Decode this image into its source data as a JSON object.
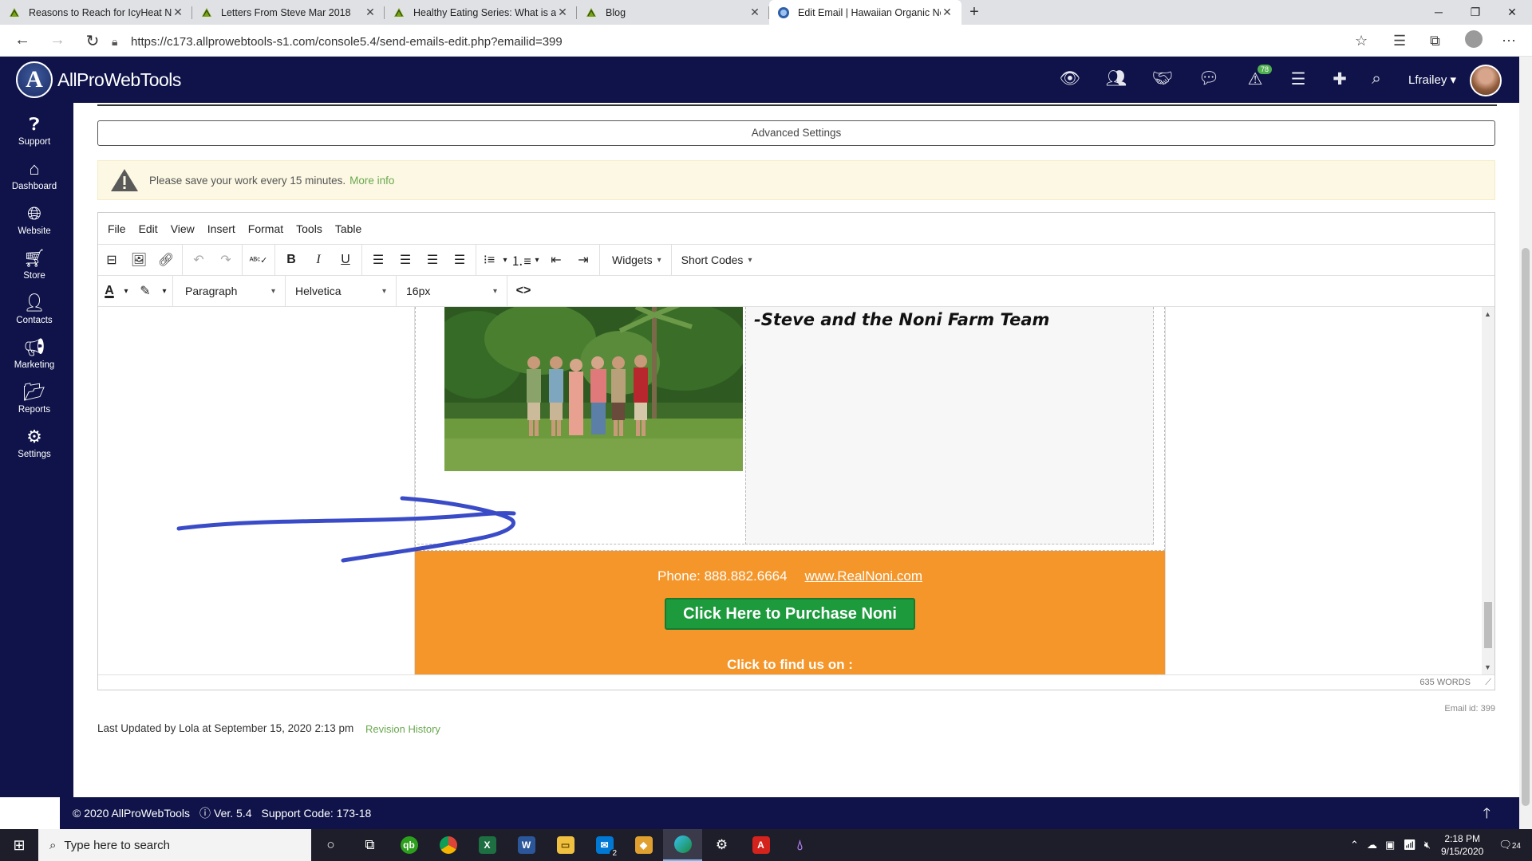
{
  "browser": {
    "tabs": [
      {
        "title": "Reasons to Reach for IcyHeat No",
        "active": false
      },
      {
        "title": "Letters From Steve Mar 2018",
        "active": false
      },
      {
        "title": "Healthy Eating Series: What is a",
        "active": false
      },
      {
        "title": "Blog",
        "active": false
      },
      {
        "title": "Edit Email | Hawaiian Organic No",
        "active": true
      }
    ],
    "url": "https://c173.allprowebtools-s1.com/console5.4/send-emails-edit.php?emailid=399"
  },
  "header": {
    "brand": "AllProWebTools",
    "notification_count": "78",
    "username": "Lfrailey"
  },
  "sidebar": {
    "items": [
      {
        "label": "Support",
        "icon": "question-icon"
      },
      {
        "label": "Dashboard",
        "icon": "home-icon"
      },
      {
        "label": "Website",
        "icon": "globe-icon"
      },
      {
        "label": "Store",
        "icon": "cart-icon"
      },
      {
        "label": "Contacts",
        "icon": "user-icon"
      },
      {
        "label": "Marketing",
        "icon": "megaphone-icon"
      },
      {
        "label": "Reports",
        "icon": "folder-icon"
      },
      {
        "label": "Settings",
        "icon": "gear-icon"
      }
    ]
  },
  "main": {
    "advanced_settings": "Advanced Settings",
    "warning_text": "Please save your work every 15 minutes.",
    "warning_link": "More info"
  },
  "editor": {
    "menu": [
      "File",
      "Edit",
      "View",
      "Insert",
      "Format",
      "Tools",
      "Table"
    ],
    "widgets_label": "Widgets",
    "shortcodes_label": "Short Codes",
    "block_format": "Paragraph",
    "font_family": "Helvetica",
    "font_size": "16px",
    "word_count": "635 WORDS"
  },
  "email": {
    "signature": "-Steve and the Noni Farm Team",
    "phone": "Phone: 888.882.6664",
    "website": "www.RealNoni.com",
    "purchase_button": "Click Here to Purchase Noni",
    "find_us": "Click to find us on :"
  },
  "meta": {
    "email_id": "Email id: 399",
    "last_updated": "Last Updated by Lola at September 15, 2020 2:13 pm",
    "revision_history": "Revision History"
  },
  "footer": {
    "copyright": "© 2020 AllProWebTools",
    "version": "Ver. 5.4",
    "support_code": "Support Code: 173-18"
  },
  "taskbar": {
    "search_placeholder": "Type here to search",
    "mail_badge": "2",
    "time": "2:18 PM",
    "date": "9/15/2020",
    "notifications": "24"
  },
  "colors": {
    "brand_navy": "#0f1349",
    "orange": "#f4962a",
    "purchase_green": "#1c9a3c",
    "link_green": "#6aa84f",
    "annotation_blue": "#3a4bc8"
  }
}
